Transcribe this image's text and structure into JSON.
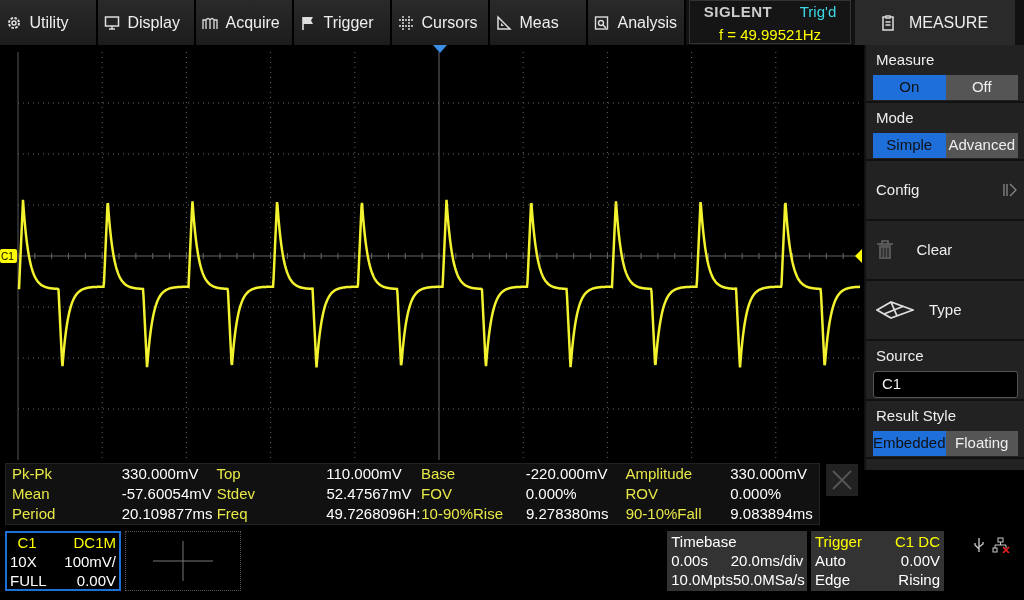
{
  "menu": [
    {
      "label": "Utility"
    },
    {
      "label": "Display"
    },
    {
      "label": "Acquire"
    },
    {
      "label": "Trigger"
    },
    {
      "label": "Cursors"
    },
    {
      "label": "Meas"
    },
    {
      "label": "Analysis"
    }
  ],
  "brand": {
    "logo": "SIGLENT",
    "trigger_status": "Trig'd",
    "frequency": "f = 49.99521Hz"
  },
  "scope": {
    "channel_marker": "C1"
  },
  "measurements": [
    {
      "name": "Pk-Pk",
      "value": "330.000mV"
    },
    {
      "name": "Top",
      "value": "110.000mV"
    },
    {
      "name": "Base",
      "value": "-220.000mV"
    },
    {
      "name": "Amplitude",
      "value": "330.000mV"
    },
    {
      "name": "Mean",
      "value": "-57.60054mV"
    },
    {
      "name": "Stdev",
      "value": "52.47567mV"
    },
    {
      "name": "FOV",
      "value": "0.000%"
    },
    {
      "name": "ROV",
      "value": "0.000%"
    },
    {
      "name": "Period",
      "value": "20.109877ms"
    },
    {
      "name": "Freq",
      "value": "49.7268096H:"
    },
    {
      "name": "10-90%Rise",
      "value": "9.278380ms"
    },
    {
      "name": "90-10%Fall",
      "value": "9.083894ms"
    }
  ],
  "panel": {
    "title": "MEASURE",
    "sections": [
      {
        "kind": "toggle",
        "label": "Measure",
        "options": [
          {
            "label": "On",
            "selected": true
          },
          {
            "label": "Off",
            "selected": false
          }
        ]
      },
      {
        "kind": "toggle",
        "label": "Mode",
        "options": [
          {
            "label": "Simple",
            "selected": true
          },
          {
            "label": "Advanced",
            "selected": false
          }
        ]
      },
      {
        "kind": "submenu",
        "label": "Config"
      },
      {
        "kind": "delete",
        "label": "Clear"
      },
      {
        "kind": "selector",
        "label": "Type"
      },
      {
        "kind": "field",
        "label": "Source",
        "value": "C1"
      },
      {
        "kind": "toggle",
        "label": "Result Style",
        "options": [
          {
            "label": "Embedded",
            "selected": true
          },
          {
            "label": "Floating",
            "selected": false
          }
        ]
      }
    ]
  },
  "channel": {
    "name": "C1",
    "coupling": "DC1M",
    "probe": "10X",
    "scale": "100mV/",
    "bandwidth": "FULL",
    "offset": "0.00V",
    "selected": true
  },
  "timebase": {
    "title": "Timebase",
    "delay": "0.00s",
    "scale": "20.0ms/div",
    "memory": "10.0Mpts",
    "sample_rate": "50.0MSa/s"
  },
  "trigger": {
    "title": "Trigger",
    "source": "C1 DC",
    "mode": "Auto",
    "level": "0.00V",
    "type": "Edge",
    "slope": "Rising"
  }
}
